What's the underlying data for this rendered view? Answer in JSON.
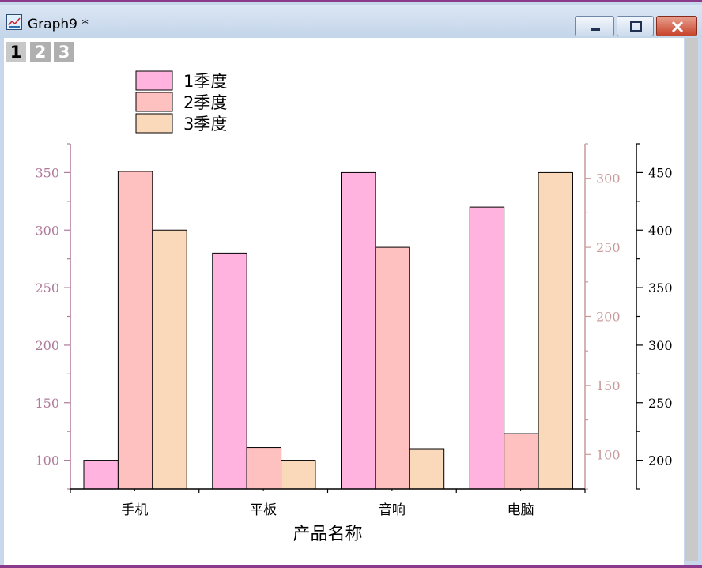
{
  "window": {
    "title": "Graph9 *",
    "layer_tabs": [
      "1",
      "2",
      "3"
    ],
    "active_layer": "1"
  },
  "chart_data": {
    "type": "bar",
    "categories": [
      "手机",
      "平板",
      "音响",
      "电脑"
    ],
    "series": [
      {
        "name": "1季度",
        "values": [
          100,
          280,
          350,
          320
        ],
        "axis": "left",
        "color": "#ffb3de"
      },
      {
        "name": "2季度",
        "values": [
          305,
          105,
          250,
          115
        ],
        "axis": "right-inner",
        "color": "#ffc0c0"
      },
      {
        "name": "3季度",
        "values": [
          400,
          200,
          210,
          450
        ],
        "axis": "right-outer",
        "color": "#fad9bb"
      }
    ],
    "xlabel": "产品名称",
    "axes": {
      "left": {
        "ylim": [
          75,
          375
        ],
        "ticks": [
          100,
          150,
          200,
          250,
          300,
          350
        ],
        "color": "#b07a9a"
      },
      "right-inner": {
        "ylim": [
          75,
          325
        ],
        "ticks": [
          100,
          150,
          200,
          250,
          300
        ],
        "color": "#c89a9a"
      },
      "right-outer": {
        "ylim": [
          175,
          475
        ],
        "ticks": [
          200,
          250,
          300,
          350,
          400,
          450
        ],
        "color": "#000000"
      }
    },
    "legend_position": "top-left",
    "grid": false
  }
}
